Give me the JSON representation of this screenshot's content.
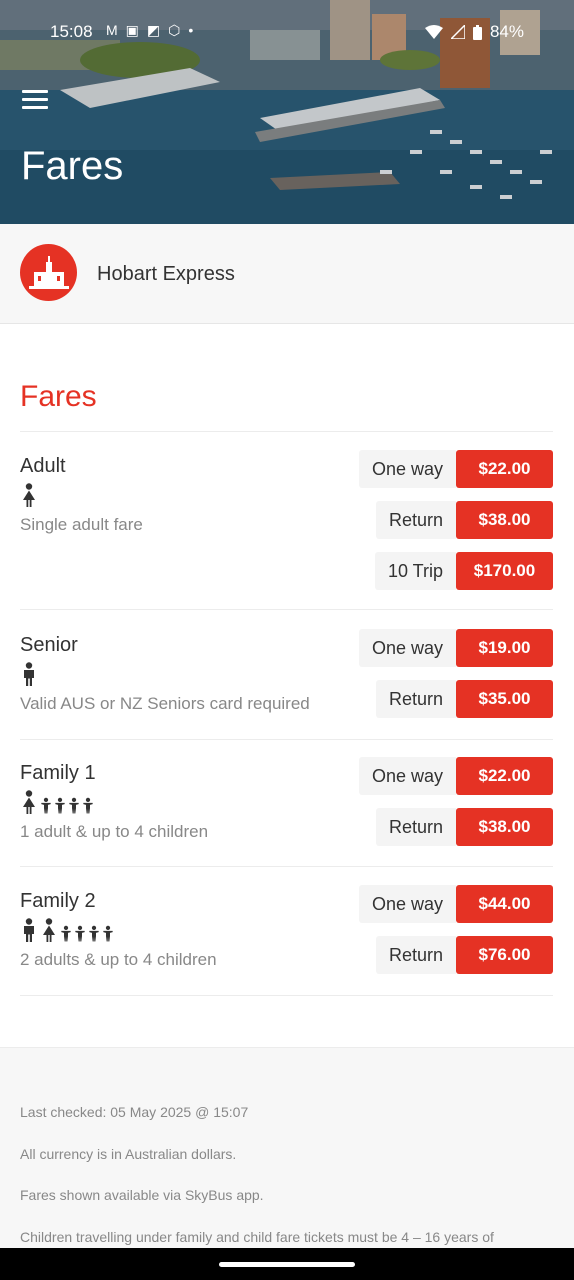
{
  "status": {
    "time": "15:08",
    "notif_icons": [
      "gmail-icon",
      "teams-icon",
      "photo-icon",
      "settings-icon",
      "dot-icon"
    ],
    "battery": "84%"
  },
  "header": {
    "title": "Fares",
    "menu_icon": "hamburger-icon"
  },
  "operator": {
    "name": "Hobart Express",
    "logo_icon": "building-icon",
    "brand_color": "#e53224"
  },
  "section": {
    "title": "Fares"
  },
  "fares": [
    {
      "name": "Adult",
      "icons": [
        "adult-female"
      ],
      "description": "Single adult fare",
      "prices": [
        {
          "label": "One way",
          "value": "$22.00"
        },
        {
          "label": "Return",
          "value": "$38.00"
        },
        {
          "label": "10 Trip",
          "value": "$170.00"
        }
      ]
    },
    {
      "name": "Senior",
      "icons": [
        "adult-male"
      ],
      "description": "Valid AUS or NZ Seniors card required",
      "prices": [
        {
          "label": "One way",
          "value": "$19.00"
        },
        {
          "label": "Return",
          "value": "$35.00"
        }
      ]
    },
    {
      "name": "Family 1",
      "icons": [
        "adult-female",
        "child",
        "child",
        "child",
        "child"
      ],
      "description": "1 adult & up to 4 children",
      "prices": [
        {
          "label": "One way",
          "value": "$22.00"
        },
        {
          "label": "Return",
          "value": "$38.00"
        }
      ]
    },
    {
      "name": "Family 2",
      "icons": [
        "adult-male",
        "adult-female",
        "child",
        "child",
        "child",
        "child"
      ],
      "description": "2 adults & up to 4 children",
      "prices": [
        {
          "label": "One way",
          "value": "$44.00"
        },
        {
          "label": "Return",
          "value": "$76.00"
        }
      ]
    }
  ],
  "footer": {
    "last_checked": "Last checked: 05 May 2025 @ 15:07",
    "currency": "All currency is in Australian dollars.",
    "app_note": "Fares shown available via SkyBus app.",
    "children_note": "Children travelling under family and child fare tickets must be 4 – 16 years of"
  }
}
